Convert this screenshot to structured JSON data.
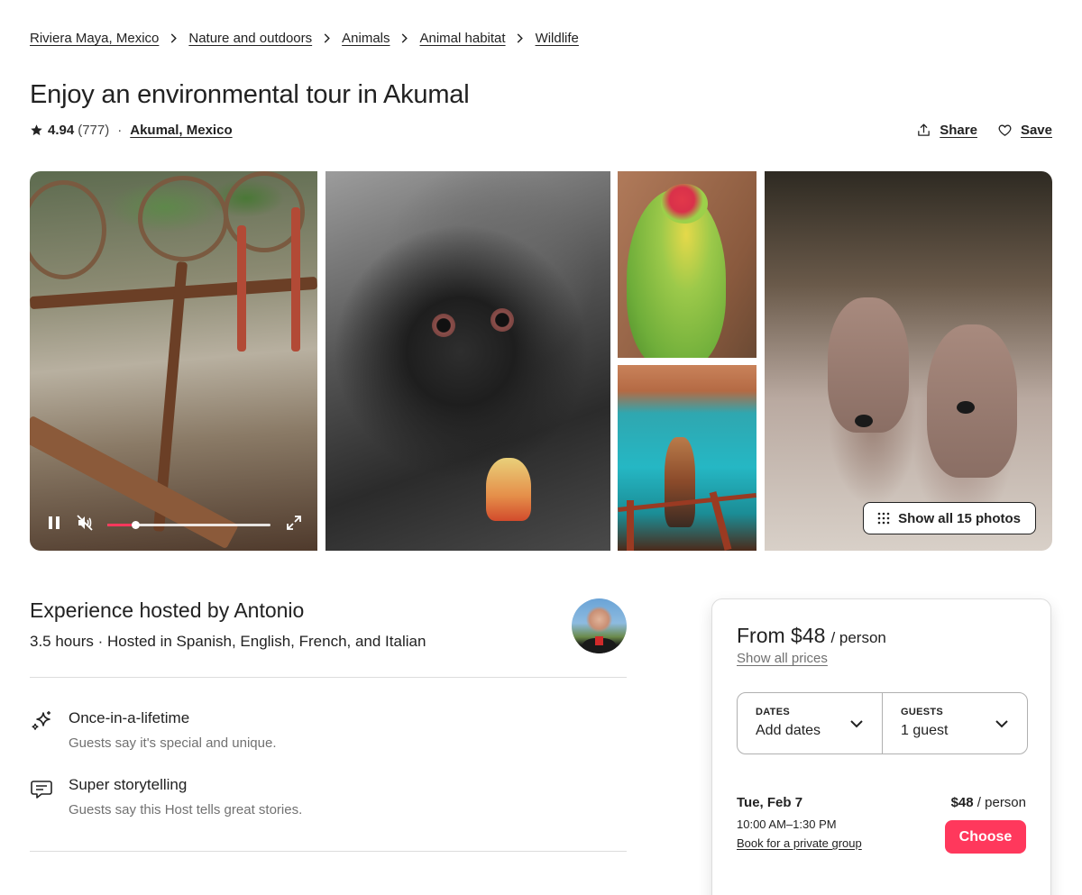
{
  "breadcrumb": [
    "Riviera Maya, Mexico",
    "Nature and outdoors",
    "Animals",
    "Animal habitat",
    "Wildlife"
  ],
  "header": {
    "title": "Enjoy an environmental tour in Akumal",
    "rating": "4.94",
    "review_count": "(777)",
    "separator": "·",
    "location": "Akumal, Mexico",
    "share_label": "Share",
    "save_label": "Save"
  },
  "gallery": {
    "show_all_label": "Show all 15 photos",
    "video_progress": 0.17
  },
  "host": {
    "title": "Experience hosted by Antonio",
    "subtitle": "3.5 hours · Hosted in Spanish, English, French, and Italian"
  },
  "features": [
    {
      "title": "Once-in-a-lifetime",
      "desc": "Guests say it's special and unique.",
      "icon": "sparkles-icon"
    },
    {
      "title": "Super storytelling",
      "desc": "Guests say this Host tells great stories.",
      "icon": "chat-bubble-icon"
    }
  ],
  "booking": {
    "price": "From $48",
    "price_unit": "/ person",
    "show_prices": "Show all prices",
    "dates_label": "DATES",
    "dates_value": "Add dates",
    "guests_label": "GUESTS",
    "guests_value": "1 guest",
    "slot_date": "Tue, Feb 7",
    "slot_time": "10:00 AM–1:30 PM",
    "slot_private": "Book for a private group",
    "slot_price": "$48",
    "slot_price_unit": "/ person",
    "choose_label": "Choose"
  },
  "colors": {
    "accent": "#ff385c",
    "text": "#222222",
    "muted": "#717171",
    "divider": "#dddddd"
  }
}
